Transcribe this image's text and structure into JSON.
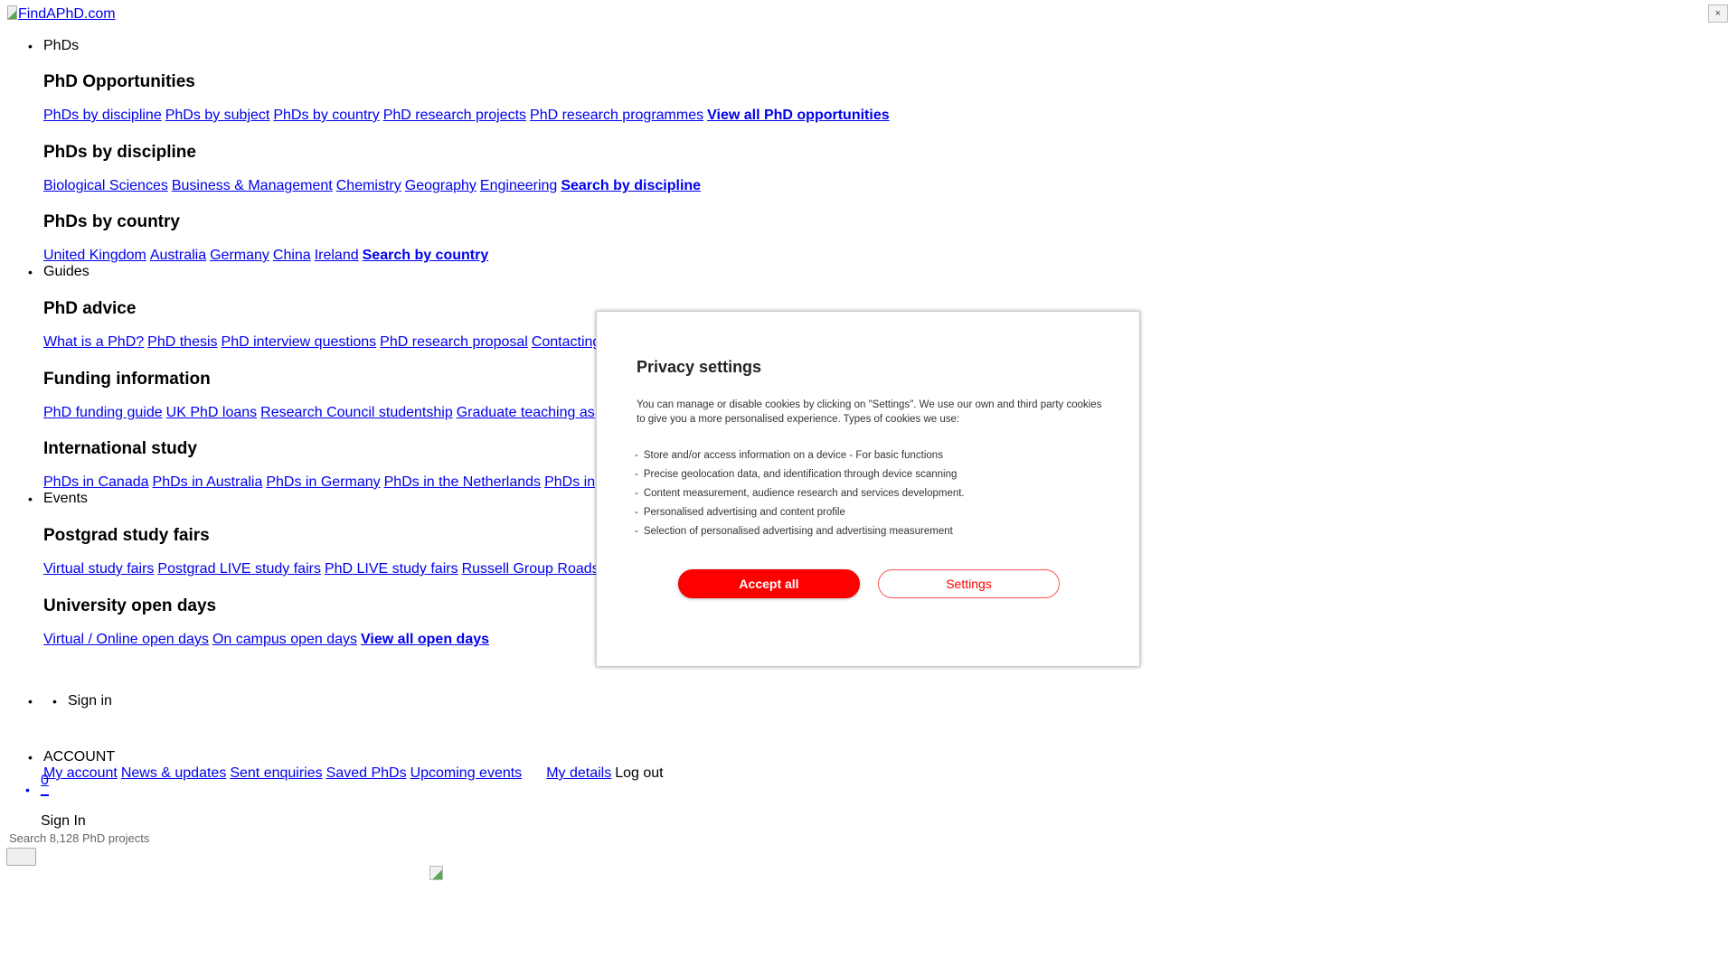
{
  "header": {
    "logo_alt": "FindAPhD.com",
    "close_label": "×"
  },
  "nav": [
    {
      "label": "PhDs",
      "sections": [
        {
          "title": "PhD Opportunities",
          "links": [
            "PhDs by discipline",
            "PhDs by subject",
            "PhDs by country",
            "PhD research projects",
            "PhD research programmes"
          ],
          "strong": "View all PhD opportunities"
        },
        {
          "title": "PhDs by discipline",
          "links": [
            "Biological Sciences",
            "Business & Management",
            "Chemistry",
            "Geography",
            "Engineering"
          ],
          "strong": "Search by discipline"
        },
        {
          "title": "PhDs by country",
          "links": [
            "United Kingdom",
            "Australia",
            "Germany",
            "China",
            "Ireland"
          ],
          "strong": "Search by country"
        }
      ]
    },
    {
      "label": "Guides",
      "sections": [
        {
          "title": "PhD advice",
          "links": [
            "What is a PhD?",
            "PhD thesis",
            "PhD interview questions",
            "PhD research proposal",
            "Contacting"
          ]
        },
        {
          "title": "Funding information",
          "links": [
            "PhD funding guide",
            "UK PhD loans",
            "Research Council studentship",
            "Graduate teaching as"
          ]
        },
        {
          "title": "International study",
          "links": [
            "PhDs in Canada",
            "PhDs in Australia",
            "PhDs in Germany",
            "PhDs in the Netherlands",
            "PhDs in"
          ]
        }
      ]
    },
    {
      "label": "Events",
      "sections": [
        {
          "title": "Postgrad study fairs",
          "links": [
            "Virtual study fairs",
            "Postgrad LIVE study fairs",
            "PhD LIVE study fairs",
            "Russell Group Roads"
          ]
        },
        {
          "title": "University open days",
          "links": [
            "Virtual / Online open days",
            "On campus open days"
          ],
          "strong": "View all open days"
        }
      ]
    }
  ],
  "account": {
    "sign_in": "Sign in",
    "heading": "ACCOUNT",
    "links": [
      "My account",
      "News & updates",
      "Sent enquiries",
      "Saved PhDs",
      "Upcoming events"
    ],
    "my_details": "My details",
    "log_out": "Log out",
    "count": "0",
    "underscore_link": "_",
    "sign_in_2": "Sign In"
  },
  "search": {
    "label": "Search 8,128 PhD projects"
  },
  "privacy_modal": {
    "title": "Privacy settings",
    "description": "You can manage or disable cookies by clicking on \"Settings\". We use our own and third party cookies to give you a more personalised experience. Types of cookies we use:",
    "items": [
      "Store and/or access information on a device  -  For basic functions",
      "Precise geolocation data, and identification through device scanning",
      "Content measurement, audience research and services development.",
      "Personalised advertising and content profile",
      "Selection of personalised advertising and advertising measurement"
    ],
    "accept_label": "Accept all",
    "settings_label": "Settings",
    "accent_color": "#ff0000"
  }
}
